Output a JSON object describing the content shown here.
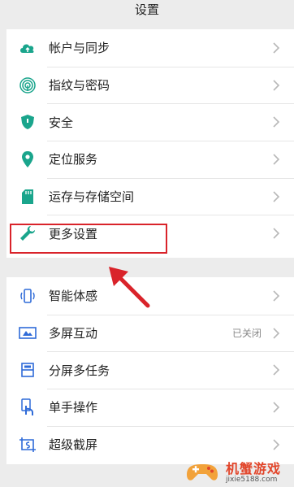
{
  "header": {
    "title": "设置"
  },
  "group1": [
    {
      "label": "帐户与同步",
      "icon": "cloud-icon"
    },
    {
      "label": "指纹与密码",
      "icon": "fingerprint-icon"
    },
    {
      "label": "安全",
      "icon": "shield-icon"
    },
    {
      "label": "定位服务",
      "icon": "location-icon"
    },
    {
      "label": "运存与存储空间",
      "icon": "sd-card-icon"
    },
    {
      "label": "更多设置",
      "icon": "wrench-icon"
    }
  ],
  "group2": [
    {
      "label": "智能体感",
      "value": "",
      "icon": "motion-phone-icon"
    },
    {
      "label": "多屏互动",
      "value": "已关闭",
      "icon": "screen-cast-icon"
    },
    {
      "label": "分屏多任务",
      "value": "",
      "icon": "split-screen-icon"
    },
    {
      "label": "单手操作",
      "value": "",
      "icon": "one-hand-icon"
    },
    {
      "label": "超级截屏",
      "value": "",
      "icon": "screenshot-icon"
    }
  ],
  "watermark": {
    "title": "机蟹游戏",
    "url": "jixie5188.com"
  },
  "colors": {
    "accent_teal": "#1aa58c",
    "accent_blue": "#2f6bd8",
    "highlight_red": "#d9232a"
  }
}
